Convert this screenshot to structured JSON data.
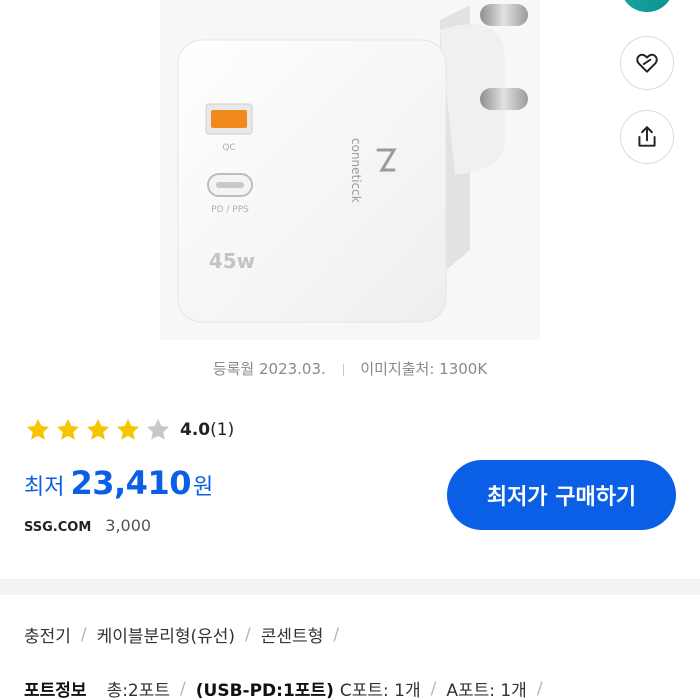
{
  "product_image": {
    "brand_text": "conneticck",
    "qc_label": "QC",
    "pd_label": "PD / PPS",
    "wattage": "45w"
  },
  "registration": {
    "date": "등록월 2023.03.",
    "image_source": "이미지출처: 1300K"
  },
  "rating": {
    "score": "4.0",
    "count": "(1)",
    "stars_filled": 4,
    "stars_total": 5
  },
  "price": {
    "prefix": "최저",
    "value": "23,410",
    "unit": "원"
  },
  "seller": {
    "name": "SSG.COM",
    "shipping": "3,000"
  },
  "buy_button": {
    "label": "최저가 구매하기"
  },
  "categories": [
    "충전기",
    "케이블분리형(유선)",
    "콘센트형"
  ],
  "port_info": {
    "label": "포트정보",
    "items": [
      "총:2포트",
      "(USB-PD:1포트)",
      "C포트: 1개",
      "A포트: 1개"
    ]
  },
  "colors": {
    "accent": "#0b5fe6",
    "star_filled": "#f7c400",
    "star_empty": "#c8c8c8"
  }
}
